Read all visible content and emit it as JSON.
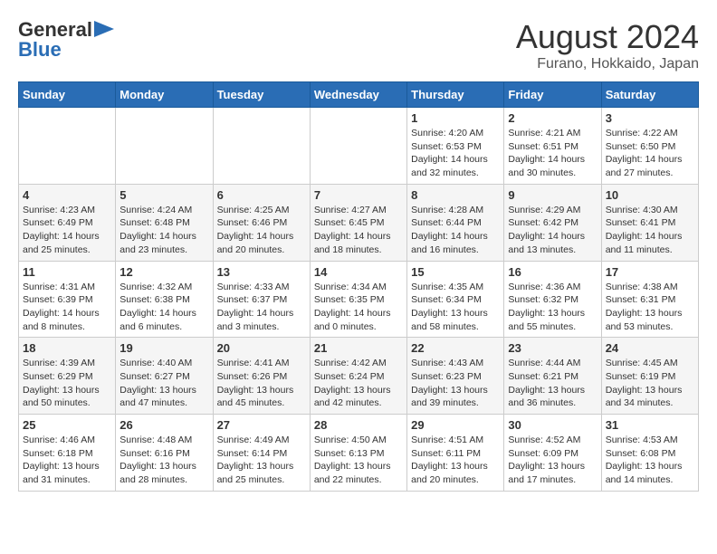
{
  "header": {
    "logo_general": "General",
    "logo_blue": "Blue",
    "title": "August 2024",
    "subtitle": "Furano, Hokkaido, Japan"
  },
  "days_of_week": [
    "Sunday",
    "Monday",
    "Tuesday",
    "Wednesday",
    "Thursday",
    "Friday",
    "Saturday"
  ],
  "weeks": [
    [
      {
        "day": "",
        "info": ""
      },
      {
        "day": "",
        "info": ""
      },
      {
        "day": "",
        "info": ""
      },
      {
        "day": "",
        "info": ""
      },
      {
        "day": "1",
        "info": "Sunrise: 4:20 AM\nSunset: 6:53 PM\nDaylight: 14 hours\nand 32 minutes."
      },
      {
        "day": "2",
        "info": "Sunrise: 4:21 AM\nSunset: 6:51 PM\nDaylight: 14 hours\nand 30 minutes."
      },
      {
        "day": "3",
        "info": "Sunrise: 4:22 AM\nSunset: 6:50 PM\nDaylight: 14 hours\nand 27 minutes."
      }
    ],
    [
      {
        "day": "4",
        "info": "Sunrise: 4:23 AM\nSunset: 6:49 PM\nDaylight: 14 hours\nand 25 minutes."
      },
      {
        "day": "5",
        "info": "Sunrise: 4:24 AM\nSunset: 6:48 PM\nDaylight: 14 hours\nand 23 minutes."
      },
      {
        "day": "6",
        "info": "Sunrise: 4:25 AM\nSunset: 6:46 PM\nDaylight: 14 hours\nand 20 minutes."
      },
      {
        "day": "7",
        "info": "Sunrise: 4:27 AM\nSunset: 6:45 PM\nDaylight: 14 hours\nand 18 minutes."
      },
      {
        "day": "8",
        "info": "Sunrise: 4:28 AM\nSunset: 6:44 PM\nDaylight: 14 hours\nand 16 minutes."
      },
      {
        "day": "9",
        "info": "Sunrise: 4:29 AM\nSunset: 6:42 PM\nDaylight: 14 hours\nand 13 minutes."
      },
      {
        "day": "10",
        "info": "Sunrise: 4:30 AM\nSunset: 6:41 PM\nDaylight: 14 hours\nand 11 minutes."
      }
    ],
    [
      {
        "day": "11",
        "info": "Sunrise: 4:31 AM\nSunset: 6:39 PM\nDaylight: 14 hours\nand 8 minutes."
      },
      {
        "day": "12",
        "info": "Sunrise: 4:32 AM\nSunset: 6:38 PM\nDaylight: 14 hours\nand 6 minutes."
      },
      {
        "day": "13",
        "info": "Sunrise: 4:33 AM\nSunset: 6:37 PM\nDaylight: 14 hours\nand 3 minutes."
      },
      {
        "day": "14",
        "info": "Sunrise: 4:34 AM\nSunset: 6:35 PM\nDaylight: 14 hours\nand 0 minutes."
      },
      {
        "day": "15",
        "info": "Sunrise: 4:35 AM\nSunset: 6:34 PM\nDaylight: 13 hours\nand 58 minutes."
      },
      {
        "day": "16",
        "info": "Sunrise: 4:36 AM\nSunset: 6:32 PM\nDaylight: 13 hours\nand 55 minutes."
      },
      {
        "day": "17",
        "info": "Sunrise: 4:38 AM\nSunset: 6:31 PM\nDaylight: 13 hours\nand 53 minutes."
      }
    ],
    [
      {
        "day": "18",
        "info": "Sunrise: 4:39 AM\nSunset: 6:29 PM\nDaylight: 13 hours\nand 50 minutes."
      },
      {
        "day": "19",
        "info": "Sunrise: 4:40 AM\nSunset: 6:27 PM\nDaylight: 13 hours\nand 47 minutes."
      },
      {
        "day": "20",
        "info": "Sunrise: 4:41 AM\nSunset: 6:26 PM\nDaylight: 13 hours\nand 45 minutes."
      },
      {
        "day": "21",
        "info": "Sunrise: 4:42 AM\nSunset: 6:24 PM\nDaylight: 13 hours\nand 42 minutes."
      },
      {
        "day": "22",
        "info": "Sunrise: 4:43 AM\nSunset: 6:23 PM\nDaylight: 13 hours\nand 39 minutes."
      },
      {
        "day": "23",
        "info": "Sunrise: 4:44 AM\nSunset: 6:21 PM\nDaylight: 13 hours\nand 36 minutes."
      },
      {
        "day": "24",
        "info": "Sunrise: 4:45 AM\nSunset: 6:19 PM\nDaylight: 13 hours\nand 34 minutes."
      }
    ],
    [
      {
        "day": "25",
        "info": "Sunrise: 4:46 AM\nSunset: 6:18 PM\nDaylight: 13 hours\nand 31 minutes."
      },
      {
        "day": "26",
        "info": "Sunrise: 4:48 AM\nSunset: 6:16 PM\nDaylight: 13 hours\nand 28 minutes."
      },
      {
        "day": "27",
        "info": "Sunrise: 4:49 AM\nSunset: 6:14 PM\nDaylight: 13 hours\nand 25 minutes."
      },
      {
        "day": "28",
        "info": "Sunrise: 4:50 AM\nSunset: 6:13 PM\nDaylight: 13 hours\nand 22 minutes."
      },
      {
        "day": "29",
        "info": "Sunrise: 4:51 AM\nSunset: 6:11 PM\nDaylight: 13 hours\nand 20 minutes."
      },
      {
        "day": "30",
        "info": "Sunrise: 4:52 AM\nSunset: 6:09 PM\nDaylight: 13 hours\nand 17 minutes."
      },
      {
        "day": "31",
        "info": "Sunrise: 4:53 AM\nSunset: 6:08 PM\nDaylight: 13 hours\nand 14 minutes."
      }
    ]
  ]
}
